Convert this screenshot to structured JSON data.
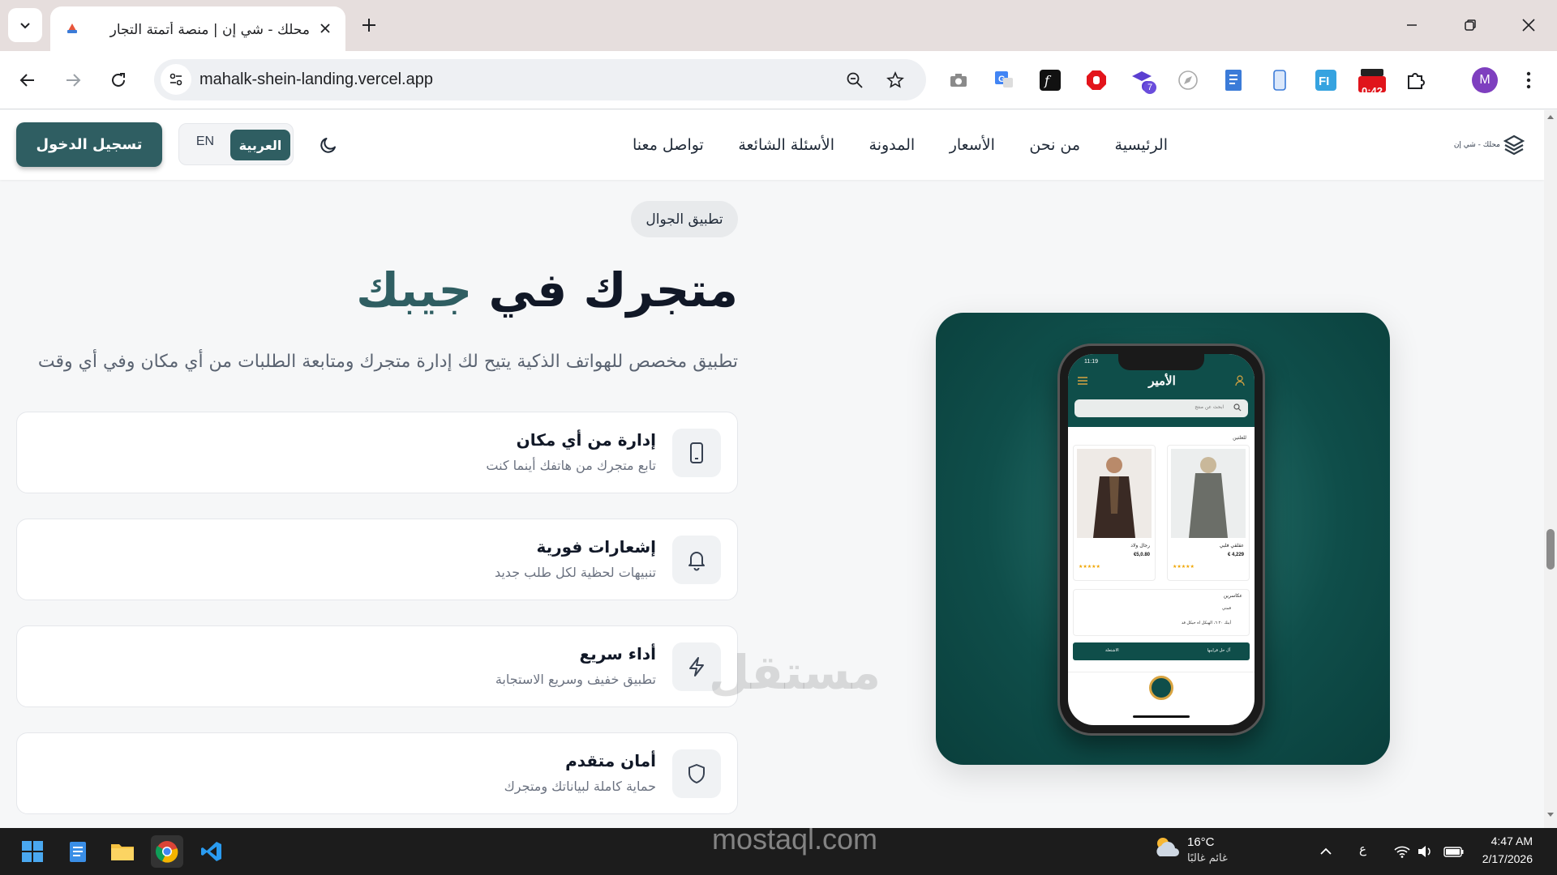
{
  "browser": {
    "tab_title": "محلك - شي إن | منصة أتمتة التجار",
    "url": "mahalk-shein-landing.vercel.app",
    "extension_badge_count": "7",
    "extension_timer": "0:42",
    "profile_initial": "M"
  },
  "header": {
    "brand_text": "محلك - شي إن",
    "nav": [
      "الرئيسية",
      "من نحن",
      "الأسعار",
      "المدونة",
      "الأسئلة الشائعة",
      "تواصل معنا"
    ],
    "lang_ar": "العربية",
    "lang_en": "EN",
    "login_label": "تسجيل الدخول"
  },
  "hero": {
    "badge": "تطبيق الجوال",
    "headline_main": "متجرك في",
    "headline_accent": "جيبك",
    "subtitle": "تطبيق مخصص للهواتف الذكية يتيح لك إدارة متجرك ومتابعة الطلبات من أي مكان وفي أي وقت",
    "features": [
      {
        "title": "إدارة من أي مكان",
        "desc": "تابع متجرك من هاتفك أينما كنت",
        "icon": "smartphone-icon"
      },
      {
        "title": "إشعارات فورية",
        "desc": "تنبيهات لحظية لكل طلب جديد",
        "icon": "bell-icon"
      },
      {
        "title": "أداء سريع",
        "desc": "تطبيق خفيف وسريع الاستجابة",
        "icon": "lightning-icon"
      },
      {
        "title": "أمان متقدم",
        "desc": "حماية كاملة لبياناتك ومتجرك",
        "icon": "shield-icon"
      }
    ]
  },
  "phone_app": {
    "time": "11:19",
    "logo": "الأمير",
    "search_placeholder": "ابحث عن منتج",
    "section": "للعلتين",
    "products": [
      {
        "name": "عقلقي فلبي",
        "price": "€ 4,229"
      },
      {
        "name": "رجال ولاد",
        "price": "€5,0.80"
      }
    ],
    "cart_title": "عكاسرين",
    "cart_line_1": "قمتي",
    "cart_line_2": "أيبك ٢٠ ٦، الهيكل اه حيكل قد",
    "checkout_label": "آل حل قرايبها",
    "checkout_left": "الاشتعلة"
  },
  "watermark": {
    "arabic": "مستقل",
    "latin": "mostaql.com"
  },
  "taskbar": {
    "temperature": "16°C",
    "condition": "غائم غالبًا",
    "input_lang": "ع",
    "time": "4:47 AM",
    "date": "2/17/2026"
  },
  "colors": {
    "accent": "#2f5e62",
    "phone_bg": "#0f4e4a"
  }
}
